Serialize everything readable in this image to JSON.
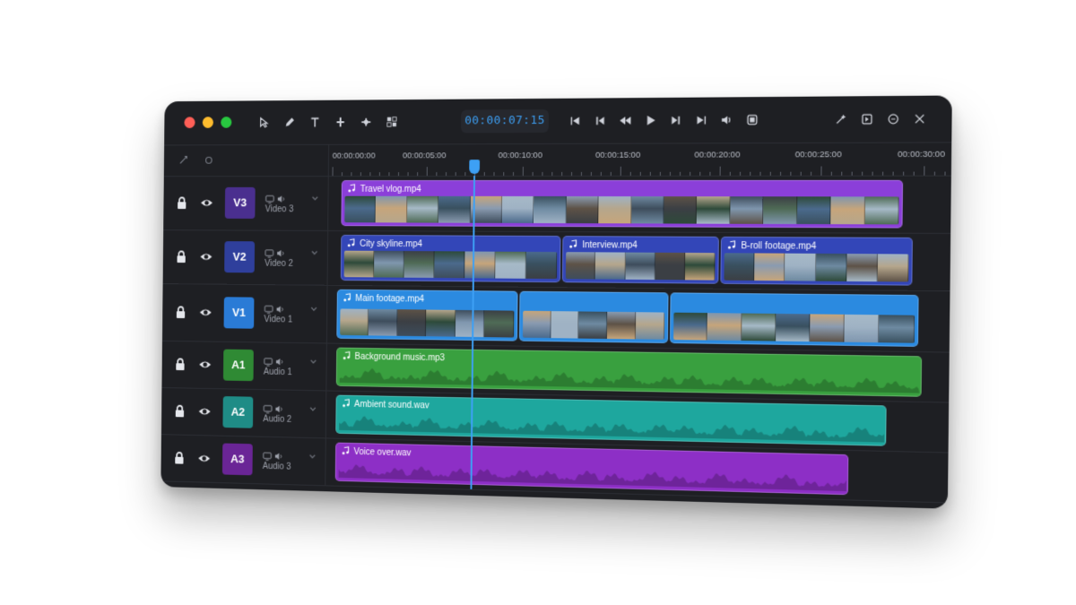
{
  "toolbar": {
    "traffic_lights": [
      "#ff5f57",
      "#febc2e",
      "#28c840"
    ],
    "left_tools": [
      "select-icon",
      "pen-icon",
      "text-icon",
      "split-icon",
      "insert-icon",
      "grid-icon"
    ],
    "timecode": "00:00:07:15",
    "transport": [
      "skip-start-icon",
      "prev-frame-icon",
      "rewind-icon",
      "play-icon",
      "next-frame-icon",
      "skip-end-icon",
      "audio-icon",
      "fullscreen-icon"
    ],
    "right_tools": [
      "magic-icon",
      "export-icon",
      "settings-icon",
      "close-icon"
    ]
  },
  "ruler": {
    "labels": [
      "00:00:00:00",
      "00:00:05:00",
      "00:00:10:00",
      "00:00:15:00",
      "00:00:20:00",
      "00:00:25:00",
      "00:00:30:00"
    ]
  },
  "playhead_seconds": 7.5,
  "tracks": [
    {
      "id": "V3",
      "name": "Video 3",
      "color": "#4a2f8f",
      "type": "video",
      "clips": [
        {
          "label": "Travel vlog.mp4",
          "start": 0.5,
          "end": 29.0,
          "color": "#8b3fd9"
        }
      ]
    },
    {
      "id": "V2",
      "name": "Video 2",
      "color": "#2f3f9c",
      "type": "video",
      "clips": [
        {
          "label": "City skyline.mp4",
          "start": 0.5,
          "end": 12.0,
          "color": "#3346b8"
        },
        {
          "label": "Interview.mp4",
          "start": 12.1,
          "end": 20.0,
          "color": "#3346b8"
        },
        {
          "label": "B-roll footage.mp4",
          "start": 20.1,
          "end": 29.5,
          "color": "#3346b8"
        }
      ]
    },
    {
      "id": "V1",
      "name": "Video 1",
      "color": "#2a7bd6",
      "type": "video",
      "clips": [
        {
          "label": "Main footage.mp4",
          "start": 0.3,
          "end": 9.8,
          "color": "#2b8ae0"
        },
        {
          "label": "",
          "start": 9.9,
          "end": 17.5,
          "color": "#2b8ae0"
        },
        {
          "label": "",
          "start": 17.6,
          "end": 29.8,
          "color": "#2b8ae0"
        }
      ]
    },
    {
      "id": "A1",
      "name": "Audio 1",
      "color": "#2f8a34",
      "type": "audio",
      "clips": [
        {
          "label": "Background music.mp3",
          "start": 0.3,
          "end": 30.0,
          "color": "#39a03f"
        }
      ]
    },
    {
      "id": "A2",
      "name": "Audio 2",
      "color": "#1f8c86",
      "type": "audio",
      "clips": [
        {
          "label": "Ambient sound.wav",
          "start": 0.3,
          "end": 28.3,
          "color": "#1ea79e"
        }
      ]
    },
    {
      "id": "A3",
      "name": "Audio 3",
      "color": "#6a2596",
      "type": "audio",
      "clips": [
        {
          "label": "Voice over.wav",
          "start": 0.3,
          "end": 26.5,
          "color": "#8d2fc6"
        }
      ]
    }
  ]
}
